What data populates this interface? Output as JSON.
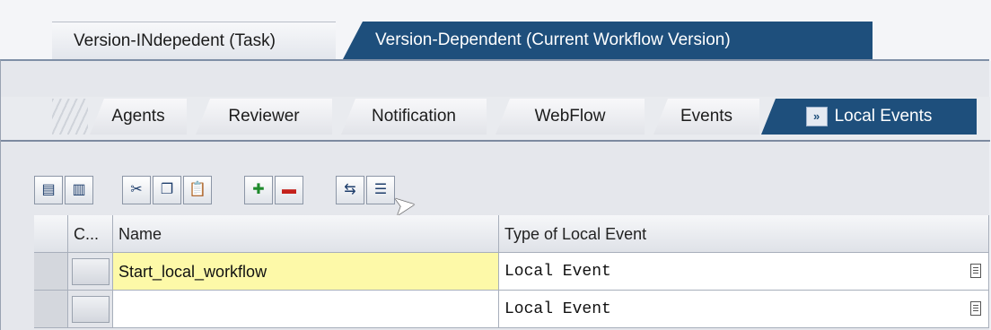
{
  "top_tabs": [
    {
      "label": "Version-INdepedent (Task)",
      "active": false
    },
    {
      "label": "Version-Dependent (Current Workflow Version)",
      "active": true
    }
  ],
  "sub_tabs": [
    {
      "label": "Agents",
      "active": false
    },
    {
      "label": "Reviewer",
      "active": false
    },
    {
      "label": "Notification",
      "active": false
    },
    {
      "label": "WebFlow",
      "active": false
    },
    {
      "label": "Events",
      "active": false
    },
    {
      "label": "Local Events",
      "active": true,
      "icon": "local-events-icon"
    }
  ],
  "toolbar": [
    {
      "icon": "append-row-icon"
    },
    {
      "icon": "insert-row-icon"
    },
    {
      "icon": "cut-icon"
    },
    {
      "icon": "copy-icon"
    },
    {
      "icon": "paste-icon"
    },
    {
      "icon": "add-icon"
    },
    {
      "icon": "delete-icon"
    },
    {
      "icon": "transfer-icon"
    },
    {
      "icon": "details-icon"
    }
  ],
  "table": {
    "columns": [
      "C...",
      "Name",
      "Type of Local Event"
    ],
    "rows": [
      {
        "name": "Start_local_workflow",
        "type": "Local Event"
      },
      {
        "name": "",
        "type": "Local Event"
      }
    ]
  },
  "colors": {
    "accent": "#1e4f7c",
    "highlight": "#fdf9a8"
  }
}
